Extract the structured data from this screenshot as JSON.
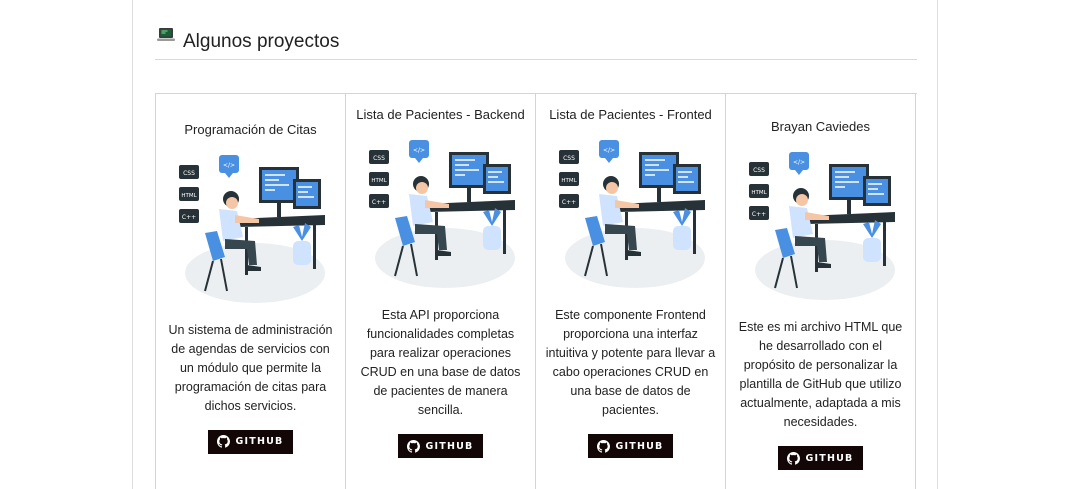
{
  "section": {
    "title": "Algunos proyectos",
    "icon": "laptop-icon"
  },
  "projects": [
    {
      "title": "Programación de Citas",
      "description": "Un sistema de administración de agendas de servicios con un módulo que permite la programación de citas para dichos servicios.",
      "button_label": "GITHUB",
      "button_icon": "github-icon"
    },
    {
      "title": "Lista de Pacientes - Backend",
      "description": "Esta API proporciona funcionalidades completas para realizar operaciones CRUD en una base de datos de pacientes de manera sencilla.",
      "button_label": "GITHUB",
      "button_icon": "github-icon"
    },
    {
      "title": "Lista de Pacientes - Fronted",
      "description": "Este componente Frontend proporciona una interfaz intuitiva y potente para llevar a cabo operaciones CRUD en una base de datos de pacientes.",
      "button_label": "GITHUB",
      "button_icon": "github-icon"
    },
    {
      "title": "Brayan Caviedes",
      "description": "Este es mi archivo HTML que he desarrollado con el propósito de personalizar la plantilla de GitHub que utilizo actualmente, adaptada a mis necesidades.",
      "button_label": "GITHUB",
      "button_icon": "github-icon"
    }
  ],
  "illustration_labels": [
    "CSS",
    "HTML",
    "C++",
    "</>"
  ],
  "colors": {
    "button_bg": "#130606",
    "illustration_blue": "#4a90e2",
    "illustration_dark": "#263238"
  }
}
